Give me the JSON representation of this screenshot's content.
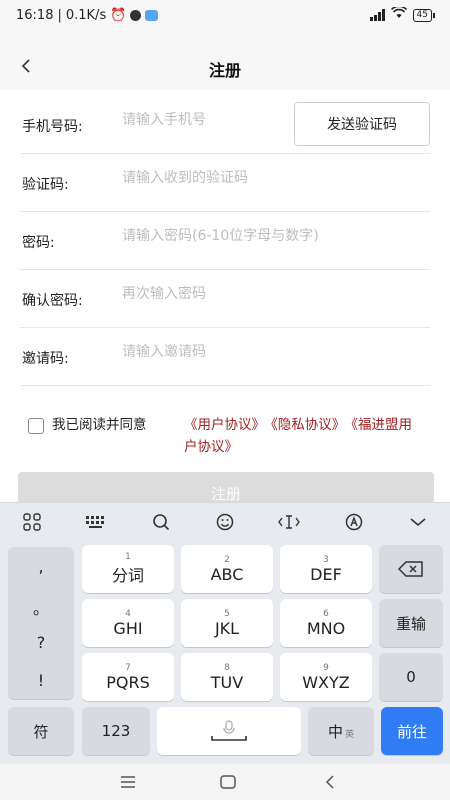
{
  "status_bar": {
    "time": "16:18",
    "net_speed": "0.1K/s",
    "battery": "45"
  },
  "header": {
    "title": "注册"
  },
  "form": {
    "phone": {
      "label": "手机号码:",
      "placeholder": "请输入手机号",
      "value": ""
    },
    "send_code_label": "发送验证码",
    "code": {
      "label": "验证码:",
      "placeholder": "请输入收到的验证码",
      "value": ""
    },
    "password": {
      "label": "密码:",
      "placeholder": "请输入密码(6-10位字母与数字)",
      "value": ""
    },
    "confirm": {
      "label": "确认密码:",
      "placeholder": "再次输入密码",
      "value": ""
    },
    "invite": {
      "label": "邀请码:",
      "placeholder": "请输入邀请码",
      "value": ""
    }
  },
  "agreement": {
    "prefix": "我已阅读并同意",
    "user_agreement": "《用户协议》",
    "privacy": "《隐私协议》",
    "fuji": "《福进盟用户协议》",
    "checked": false
  },
  "register_label": "注册",
  "keyboard": {
    "toolbar_icons": [
      "grid-icon",
      "keyboard-icon",
      "search-icon",
      "emoji-icon",
      "cursor-icon",
      "handwrite-icon",
      "collapse-icon"
    ],
    "punctuation": [
      ",",
      "。",
      "?",
      "!"
    ],
    "row1": [
      {
        "num": "1",
        "label": "分词"
      },
      {
        "num": "2",
        "label": "ABC"
      },
      {
        "num": "3",
        "label": "DEF"
      }
    ],
    "row2": [
      {
        "num": "4",
        "label": "GHI"
      },
      {
        "num": "5",
        "label": "JKL"
      },
      {
        "num": "6",
        "label": "MNO"
      }
    ],
    "row3": [
      {
        "num": "7",
        "label": "PQRS"
      },
      {
        "num": "8",
        "label": "TUV"
      },
      {
        "num": "9",
        "label": "WXYZ"
      }
    ],
    "reenter_label": "重输",
    "zero_label": "0",
    "symbol_label": "符",
    "numbers_label": "123",
    "lang_label": "中",
    "lang_sub": "英",
    "go_label": "前往"
  }
}
